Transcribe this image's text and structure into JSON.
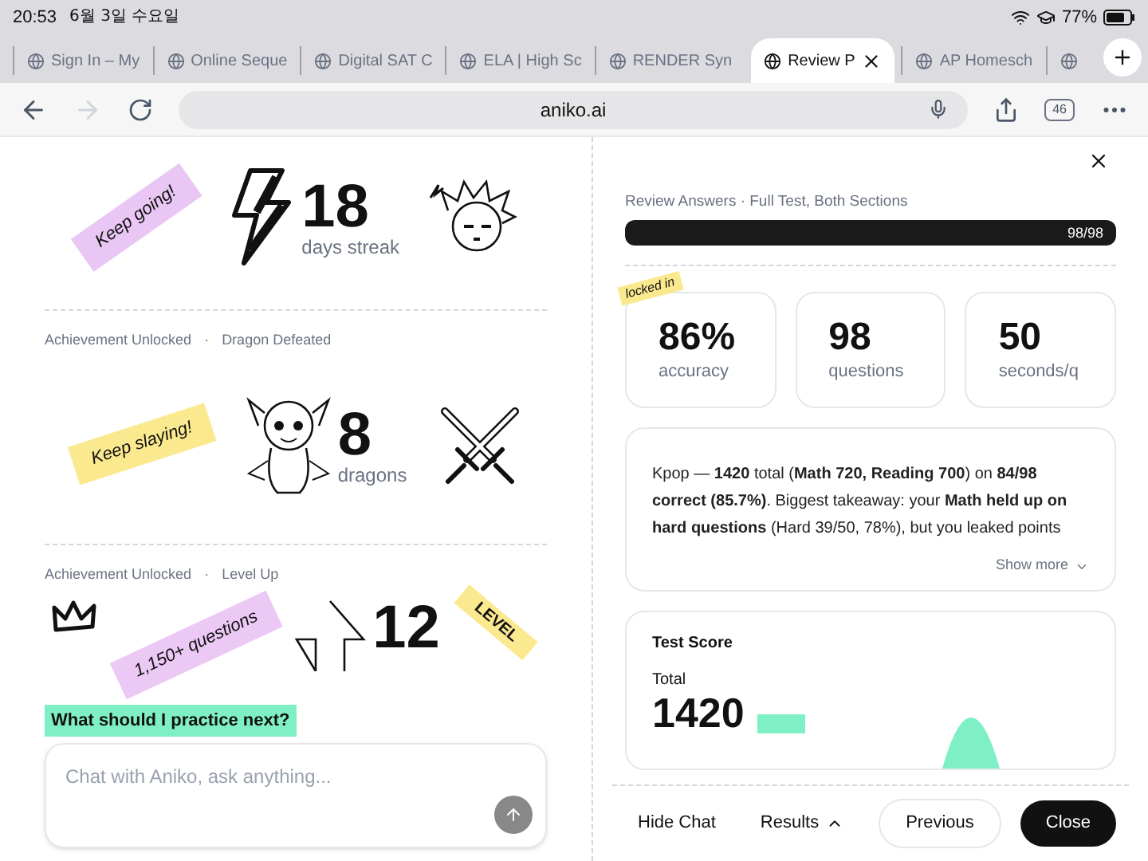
{
  "status_bar": {
    "time": "20:53",
    "date": "6월 3일 수요일",
    "battery": "77%"
  },
  "tabs": [
    {
      "title": "Sign In – My",
      "selected": false
    },
    {
      "title": "Online Seque",
      "selected": false
    },
    {
      "title": "Digital SAT C",
      "selected": false
    },
    {
      "title": "ELA | High Sc",
      "selected": false
    },
    {
      "title": "RENDER Syn",
      "selected": false
    },
    {
      "title": "Review P",
      "selected": true
    },
    {
      "title": "AP Homesch",
      "selected": false
    },
    {
      "selected": false
    }
  ],
  "address_bar": {
    "url": "aniko.ai",
    "tab_count": "46"
  },
  "achievements": [
    {
      "kind": "streak",
      "sticker": "Keep going!",
      "number": "18",
      "unit": "days streak"
    },
    {
      "kind": "dragon",
      "heading": "Achievement Unlocked",
      "separator": "·",
      "name": "Dragon Defeated",
      "sticker": "Keep slaying!",
      "number": "8",
      "unit": "dragons"
    },
    {
      "kind": "level",
      "heading": "Achievement Unlocked",
      "separator": "·",
      "name": "Level Up",
      "sticker": "1,150+ questions",
      "number": "12",
      "side_sticker": "LEVEL"
    }
  ],
  "chat": {
    "suggestion": "What should I practice next?",
    "placeholder": "Chat with Aniko, ask anything..."
  },
  "review": {
    "title": "Review Answers · Full Test, Both Sections",
    "progress": "98/98",
    "level": 1,
    "sticker": "locked in",
    "stats": [
      {
        "value": "86%",
        "label": "accuracy"
      },
      {
        "value": "98",
        "label": "questions"
      },
      {
        "value": "50",
        "label": "seconds/q"
      }
    ],
    "summary": "Kpop — **1420** total (**Math 720, Reading 700**) on **84/98 correct (85.7%)**. Biggest takeaway: your **Math held up on hard questions** (Hard 39/50, 78%), but you leaked points",
    "show_more": "Show more",
    "score": {
      "title": "Test Score",
      "label": "Total",
      "value": "1420"
    }
  },
  "footer": {
    "hide_chat": "Hide Chat",
    "results": "Results",
    "previous": "Previous",
    "close": "Close"
  }
}
